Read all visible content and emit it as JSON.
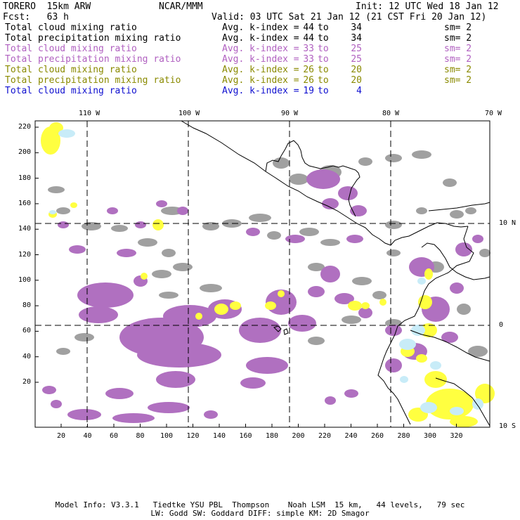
{
  "header": {
    "model": "TORERO  15km ARW",
    "center": "NCAR/MMM",
    "init": "Init: 12 UTC Wed 18 Jan 12",
    "fcst": "Fcst:   63 h",
    "valid": "Valid: 03 UTC Sat 21 Jan 12 (21 CST Fri 20 Jan 12)"
  },
  "legend": [
    {
      "name": "Total cloud mixing ratio",
      "k_label": "Avg. k-index =",
      "from": "44",
      "to_word": "to",
      "to": "34",
      "sm": "sm= 2",
      "color": "#000000"
    },
    {
      "name": "Total precipitation mixing ratio",
      "k_label": "Avg. k-index =",
      "from": "44",
      "to_word": "to",
      "to": "34",
      "sm": "sm= 2",
      "color": "#000000"
    },
    {
      "name": "Total cloud mixing ratio",
      "k_label": "Avg. k-index =",
      "from": "33",
      "to_word": "to",
      "to": "25",
      "sm": "sm= 2",
      "color": "#b060c0"
    },
    {
      "name": "Total precipitation mixing ratio",
      "k_label": "Avg. k-index =",
      "from": "33",
      "to_word": "to",
      "to": "25",
      "sm": "sm= 2",
      "color": "#b060c0"
    },
    {
      "name": "Total cloud mixing ratio",
      "k_label": "Avg. k-index =",
      "from": "26",
      "to_word": "to",
      "to": "20",
      "sm": "sm= 2",
      "color": "#8a8a00"
    },
    {
      "name": "Total precipitation mixing ratio",
      "k_label": "Avg. k-index =",
      "from": "26",
      "to_word": "to",
      "to": "20",
      "sm": "sm= 2",
      "color": "#8a8a00"
    },
    {
      "name": "Total cloud mixing ratio",
      "k_label": "Avg. k-index =",
      "from": "19",
      "to_word": "to",
      "to": "4",
      "sm": "",
      "color": "#1010d0"
    }
  ],
  "colors": {
    "gray_field": "#a0a0a0",
    "purple_field": "#b070c0",
    "yellow_field": "#ffff40",
    "lightblue_field": "#c8ecf8",
    "coast": "#000000",
    "grid": "#000000"
  },
  "longitude_labels": [
    "110 W",
    "100 W",
    "90 W",
    "80 W",
    "70 W"
  ],
  "latitude_labels": [
    "10 N",
    "0",
    "10 S"
  ],
  "x_ticks": [
    "20",
    "40",
    "60",
    "80",
    "100",
    "120",
    "140",
    "160",
    "180",
    "200",
    "220",
    "240",
    "260",
    "280",
    "300",
    "320"
  ],
  "y_ticks": [
    "220",
    "200",
    "180",
    "160",
    "140",
    "120",
    "100",
    "80",
    "60",
    "40",
    "20"
  ],
  "footer": {
    "line1": "Model Info: V3.3.1   Tiedtke YSU PBL  Thompson    Noah LSM  15 km,   44 levels,   79 sec",
    "line2": "LW: Godd SW: Goddard DIFF: simple KM: 2D Smagor"
  }
}
